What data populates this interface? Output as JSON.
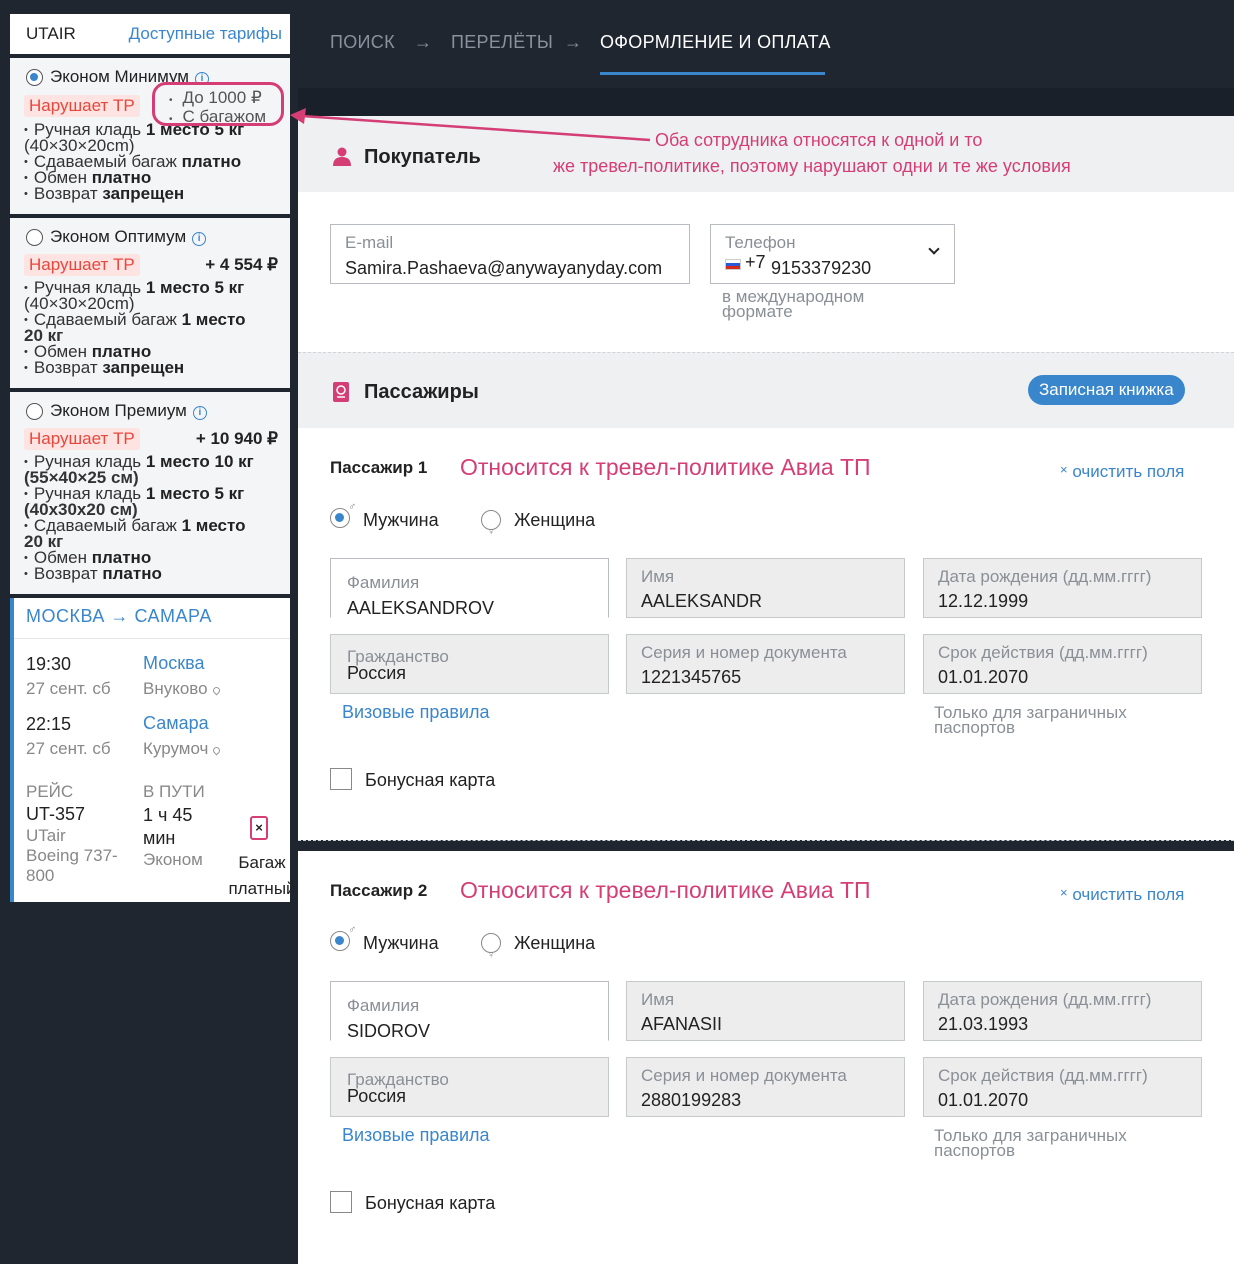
{
  "sidebar": {
    "brand": "UTAIR",
    "tariffs_link": "Доступные тарифы",
    "tariffs": [
      {
        "name": "Эконом Минимум",
        "selected": true,
        "badge": "Нарушает ТР",
        "price": "",
        "extra_points": [
          "До 1000 ₽",
          "С багажом"
        ],
        "features": [
          {
            "text": "Ручная кладь ",
            "bold": "1 место 5 кг",
            "cont": "(40×30×20cm)"
          },
          {
            "text": "Сдаваемый багаж ",
            "bold": "платно",
            "cont": ""
          },
          {
            "text": "Обмен ",
            "bold": "платно",
            "cont": ""
          },
          {
            "text": "Возврат ",
            "bold": "запрещен",
            "cont": ""
          }
        ]
      },
      {
        "name": "Эконом Оптимум",
        "selected": false,
        "badge": "Нарушает ТР",
        "price": "+ 4 554 ₽",
        "features": [
          {
            "text": "Ручная кладь ",
            "bold": "1 место 5 кг",
            "cont": "(40×30×20cm)"
          },
          {
            "text": "Сдаваемый багаж ",
            "bold": "1 место",
            "cont": "20 кг"
          },
          {
            "text": "Обмен ",
            "bold": "платно",
            "cont": ""
          },
          {
            "text": "Возврат ",
            "bold": "запрещен",
            "cont": ""
          }
        ]
      },
      {
        "name": "Эконом Премиум",
        "selected": false,
        "badge": "Нарушает ТР",
        "price": "+ 10 940 ₽",
        "features": [
          {
            "text": "Ручная кладь ",
            "bold": "1 место 10 кг",
            "cont": "(55×40×25 см)"
          },
          {
            "text": "Ручная кладь ",
            "bold": "1 место 5 кг",
            "cont": "(40х30х20 см)"
          },
          {
            "text": "Сдаваемый багаж ",
            "bold": "1 место",
            "cont": "20 кг"
          },
          {
            "text": "Обмен ",
            "bold": "платно",
            "cont": ""
          },
          {
            "text": "Возврат ",
            "bold": "платно",
            "cont": ""
          }
        ]
      }
    ],
    "route": {
      "from": "МОСКВА",
      "arrow": "→",
      "to": "САМАРА",
      "dep_time": "19:30",
      "dep_date": "27 сент. сб",
      "dep_city": "Москва",
      "dep_airport": "Внуково",
      "arr_time": "22:15",
      "arr_date": "27 сент. сб",
      "arr_city": "Самара",
      "arr_airport": "Курумоч",
      "flight_label": "РЕЙС",
      "flight_no": "UT-357",
      "airline": "UTair",
      "aircraft": "Boeing 737-800",
      "duration_label": "В ПУТИ",
      "duration": "1 ч 45 мин",
      "cabin": "Эконом",
      "baggage": "Багаж платный"
    }
  },
  "nav": {
    "steps": [
      "ПОИСК",
      "ПЕРЕЛЁТЫ",
      "ОФОРМЛЕНИЕ И ОПЛАТА"
    ],
    "arrow": "→",
    "active_index": 2
  },
  "buyer": {
    "title": "Покупатель",
    "email_label": "E-mail",
    "email_value": "Samira.Pashaeva@anywayanyday.com",
    "phone_label": "Телефон",
    "phone_code": "+7",
    "phone_value": "9153379230",
    "phone_hint": "в международном формате"
  },
  "passengers": {
    "title": "Пассажиры",
    "notebook_button": "Записная книжка",
    "list": [
      {
        "title": "Пассажир 1",
        "annotation": "Относится к тревел-политике Авиа ТП",
        "clear": "очистить поля",
        "male": "Мужчина",
        "female": "Женщина",
        "surname_label": "Фамилия",
        "surname": "AALEKSANDROV",
        "name_label": "Имя",
        "name": "AALEKSANDR",
        "dob_label": "Дата рождения (дд.мм.гггг)",
        "dob": "12.12.1999",
        "citizenship_label": "Гражданство",
        "citizenship": "Россия",
        "doc_label": "Серия и номер документа",
        "doc": "1221345765",
        "expiry_label": "Срок действия (дд.мм.гггг)",
        "expiry": "01.01.2070",
        "visa_link": "Визовые правила",
        "expiry_hint": "Только для заграничных паспортов",
        "bonus": "Бонусная карта"
      },
      {
        "title": "Пассажир 2",
        "annotation": "Относится к тревел-политике Авиа ТП",
        "clear": "очистить поля",
        "male": "Мужчина",
        "female": "Женщина",
        "surname_label": "Фамилия",
        "surname": "SIDOROV",
        "name_label": "Имя",
        "name": "AFANASII",
        "dob_label": "Дата рождения (дд.мм.гггг)",
        "dob": "21.03.1993",
        "citizenship_label": "Гражданство",
        "citizenship": "Россия",
        "doc_label": "Серия и номер документа",
        "doc": "2880199283",
        "expiry_label": "Срок действия (дд.мм.гггг)",
        "expiry": "01.01.2070",
        "visa_link": "Визовые правила",
        "expiry_hint": "Только для заграничных паспортов",
        "bonus": "Бонусная карта"
      }
    ]
  },
  "annotation_main": {
    "line1": "Оба сотрудника относятся к одной и то",
    "line2": "же тревел-политике, поэтому нарушают одни и те же условия"
  },
  "colors": {
    "accent": "#3a86cc",
    "annotation": "#d43e75",
    "violation": "#e8473c",
    "dark_bg": "#1f2630"
  }
}
